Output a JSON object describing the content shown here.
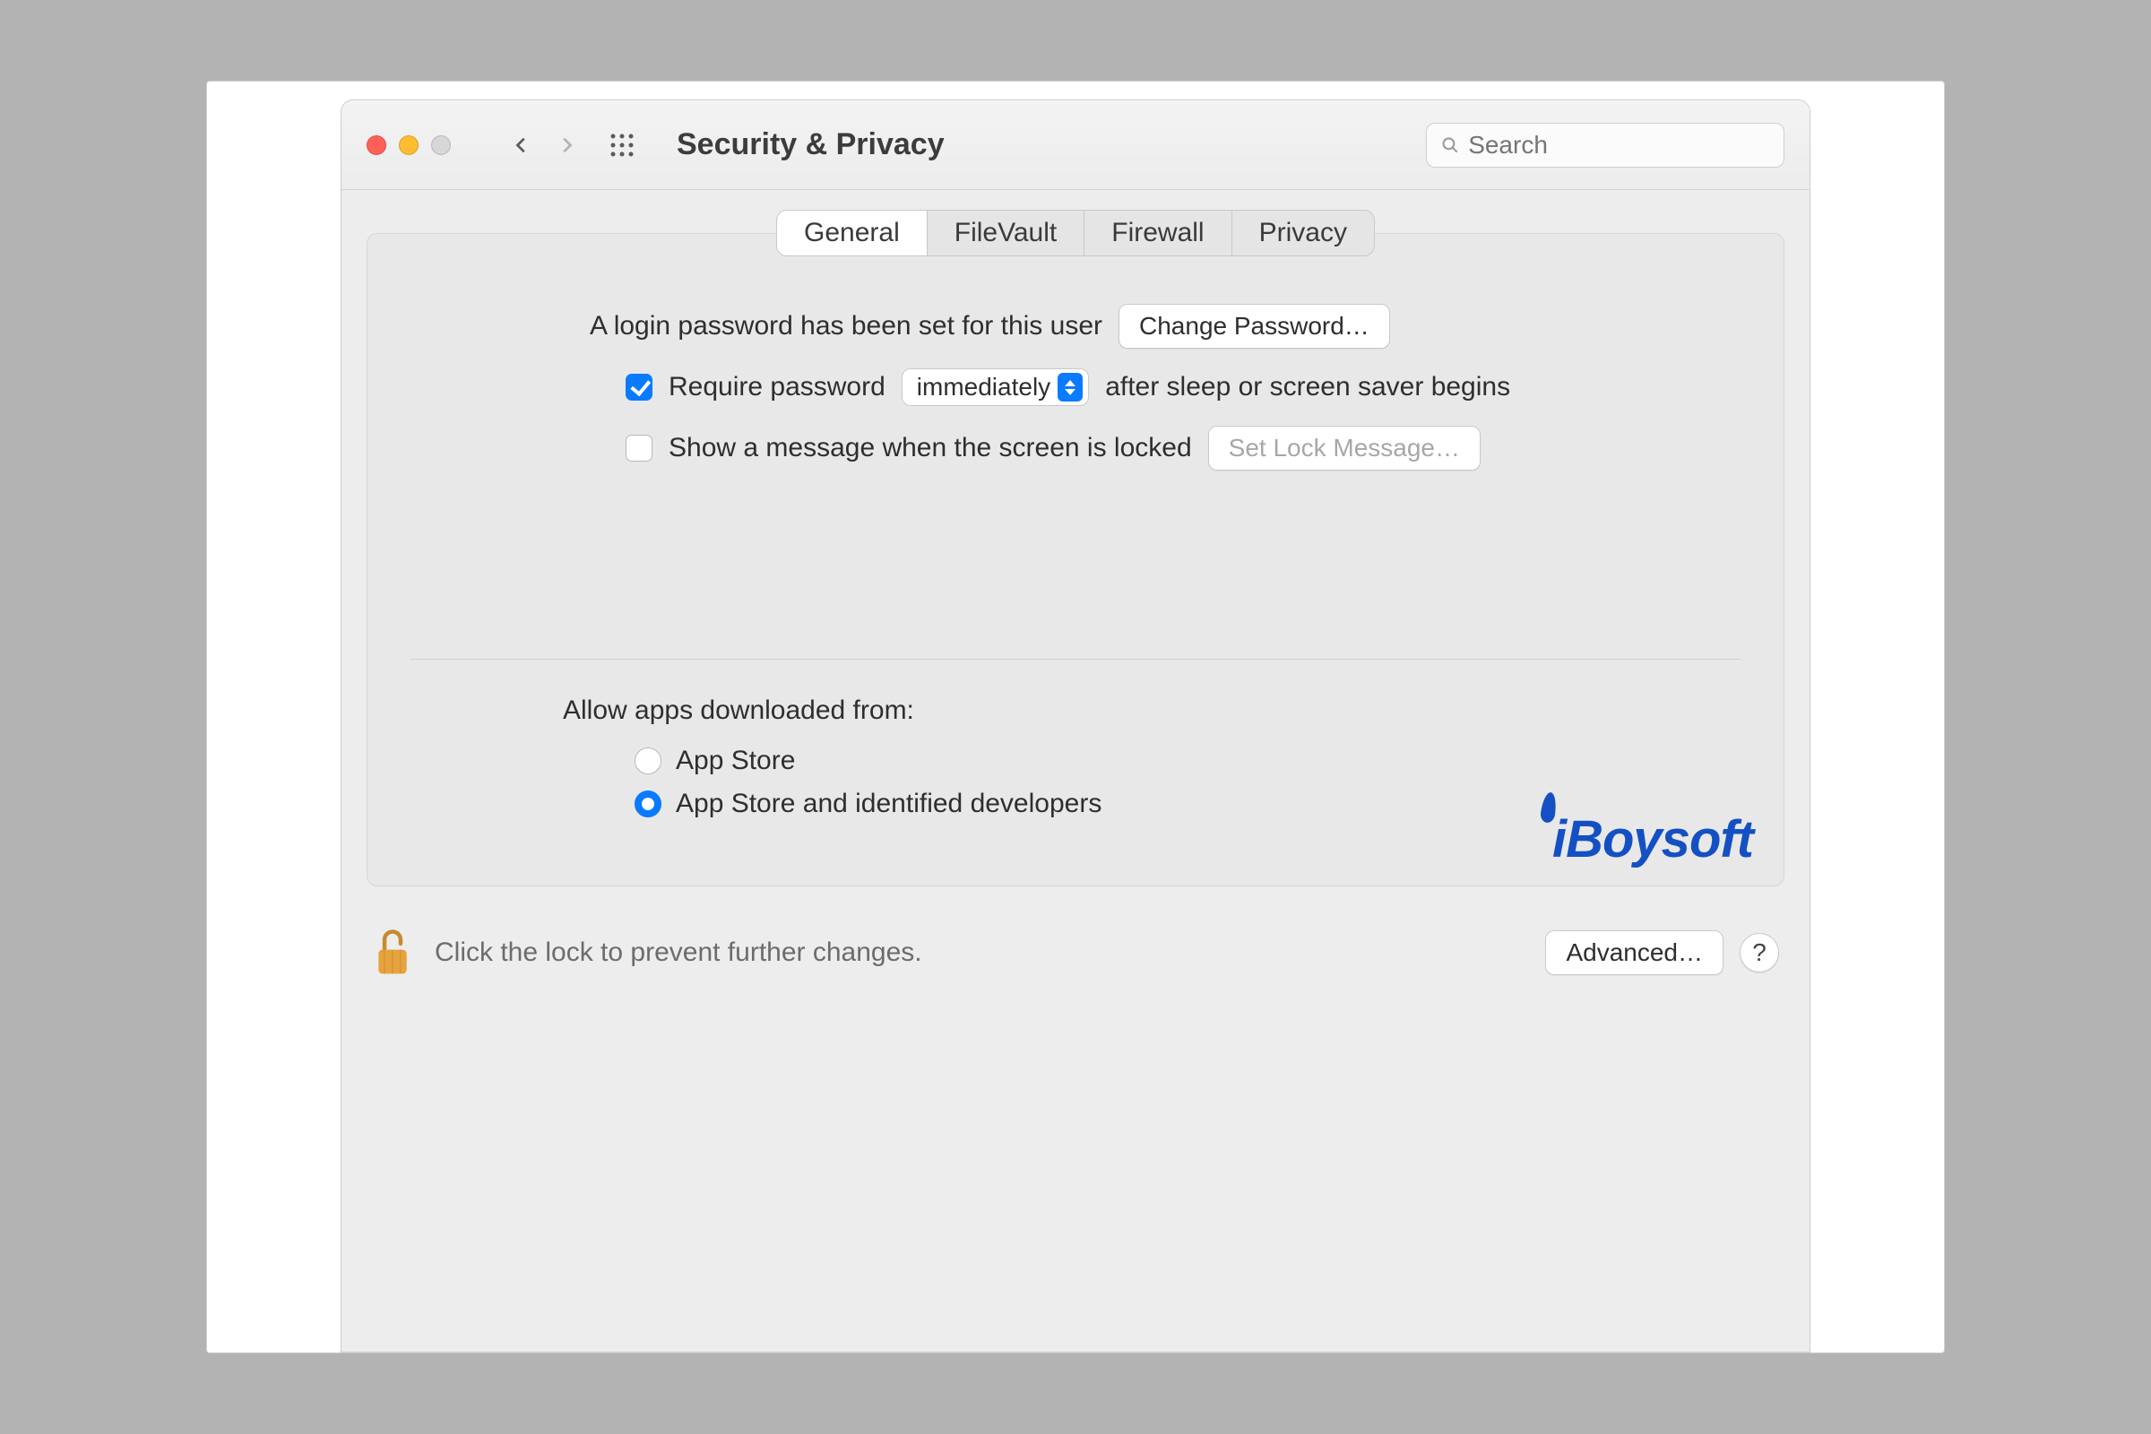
{
  "window": {
    "title": "Security & Privacy"
  },
  "search": {
    "placeholder": "Search"
  },
  "tabs": {
    "general": "General",
    "filevault": "FileVault",
    "firewall": "Firewall",
    "privacy": "Privacy",
    "active": "general"
  },
  "general": {
    "login_set": "A login password has been set for this user",
    "change_password": "Change Password…",
    "require_password_label_pre": "Require password",
    "require_password_value": "immediately",
    "require_password_label_post": "after sleep or screen saver begins",
    "require_password_checked": true,
    "show_lock_message_label": "Show a message when the screen is locked",
    "show_lock_message_checked": false,
    "set_lock_message": "Set Lock Message…",
    "allow_apps_label": "Allow apps downloaded from:",
    "allow_apps_options": {
      "app_store": "App Store",
      "identified": "App Store and identified developers"
    },
    "allow_apps_selected": "identified"
  },
  "footer": {
    "lock_text": "Click the lock to prevent further changes.",
    "advanced": "Advanced…"
  },
  "watermark": "iBoysoft"
}
